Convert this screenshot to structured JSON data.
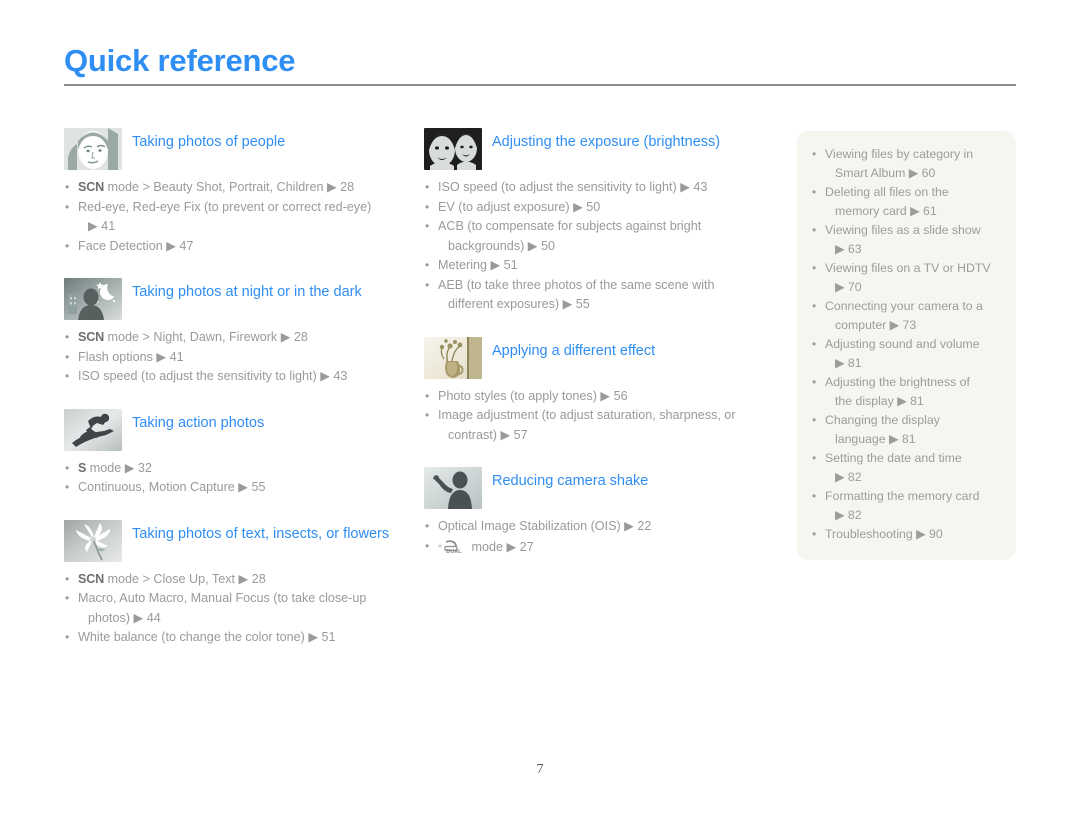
{
  "page": {
    "title": "Quick reference",
    "folio": "7",
    "accent_color": "#2f8ef4",
    "body_text_color": "#9a9a9a",
    "panel_bg_color": "#f6f5f0",
    "rule_color": "#8d8d8d"
  },
  "columns": {
    "left": [
      {
        "icon": "woman-portrait-thumbnail",
        "title": "Taking photos of people",
        "items": [
          {
            "mode": "SCN",
            "text": " mode > Beauty Shot, Portrait, Children ",
            "arrow": "▶",
            "page": "28"
          },
          {
            "mode": "",
            "text": "Red-eye, Red-eye Fix (to prevent or correct red-eye)",
            "cont": "▶ 41"
          },
          {
            "mode": "",
            "text": "Face Detection ",
            "arrow": "▶",
            "page": "47"
          }
        ]
      },
      {
        "icon": "night-scene-thumbnail",
        "title": "Taking photos at night or in the dark",
        "items": [
          {
            "mode": "SCN",
            "text": " mode > Night, Dawn, Firework ",
            "arrow": "▶",
            "page": "28"
          },
          {
            "mode": "",
            "text": "Flash options ",
            "arrow": "▶",
            "page": "41"
          },
          {
            "mode": "",
            "text": "ISO speed (to adjust the sensitivity to light) ",
            "arrow": "▶",
            "page": "43"
          }
        ]
      },
      {
        "icon": "snowboarder-thumbnail",
        "title": "Taking action photos",
        "items": [
          {
            "mode": "S",
            "text": " mode ",
            "arrow": "▶",
            "page": "32"
          },
          {
            "mode": "",
            "text": "Continuous, Motion Capture ",
            "arrow": "▶",
            "page": "55"
          }
        ]
      },
      {
        "icon": "flower-macro-thumbnail",
        "title": "Taking photos of text, insects, or flowers",
        "items": [
          {
            "mode": "SCN",
            "text": " mode > Close Up, Text ",
            "arrow": "▶",
            "page": "28"
          },
          {
            "mode": "",
            "text": "Macro, Auto Macro, Manual Focus (to take close-up photos) ",
            "cont": "▶ 44",
            "wrap_text": "Macro, Auto Macro, Manual Focus (to take close-up",
            "wrap_cont": "photos) ▶ 44"
          },
          {
            "mode": "",
            "text": "White balance (to change the color tone) ",
            "arrow": "▶",
            "page": "51"
          }
        ]
      }
    ],
    "middle": [
      {
        "icon": "two-faces-exposure-thumbnail",
        "title": "Adjusting the exposure (brightness)",
        "items": [
          {
            "mode": "",
            "text": "ISO speed (to adjust the sensitivity to light) ",
            "arrow": "▶",
            "page": "43"
          },
          {
            "mode": "",
            "text": "EV (to adjust exposure) ",
            "arrow": "▶",
            "page": "50"
          },
          {
            "mode": "",
            "wrap_text": "ACB (to compensate for subjects against bright",
            "wrap_cont": "backgrounds) ▶ 50"
          },
          {
            "mode": "",
            "text": "Metering ",
            "arrow": "▶",
            "page": "51"
          },
          {
            "mode": "",
            "wrap_text": "AEB (to take three photos of the same scene with",
            "wrap_cont": "different exposures) ▶ 55"
          }
        ]
      },
      {
        "icon": "vase-flowers-effect-thumbnail",
        "title": "Applying a different effect",
        "items": [
          {
            "mode": "",
            "text": "Photo styles (to apply tones) ",
            "arrow": "▶",
            "page": "56"
          },
          {
            "mode": "",
            "wrap_text": "Image adjustment (to adjust saturation, sharpness, or",
            "wrap_cont": "contrast) ▶ 57"
          }
        ]
      },
      {
        "icon": "person-waving-shake-thumbnail",
        "title": "Reducing camera shake",
        "items": [
          {
            "mode": "",
            "text": "Optical Image Stabilization (OIS) ",
            "arrow": "▶",
            "page": "22"
          },
          {
            "mode": "DUAL_ICON",
            "text": " mode ",
            "arrow": "▶",
            "page": "27"
          }
        ]
      }
    ]
  },
  "side_panel": {
    "items": [
      {
        "line1": "Viewing files by category in",
        "line2": "Smart Album ▶ 60"
      },
      {
        "line1": "Deleting all files on the",
        "line2": "memory card ▶ 61"
      },
      {
        "line1": "Viewing files as a slide show",
        "line2": "▶ 63"
      },
      {
        "line1": "Viewing files on a TV or HDTV",
        "line2": "▶ 70"
      },
      {
        "line1": "Connecting your camera to a",
        "line2": "computer ▶ 73"
      },
      {
        "line1": "Adjusting sound and volume",
        "line2": "▶ 81"
      },
      {
        "line1": "Adjusting the brightness of",
        "line2": "the display ▶ 81"
      },
      {
        "line1": "Changing the display",
        "line2": "language ▶ 81"
      },
      {
        "line1": "Setting the date and time",
        "line2": "▶ 82"
      },
      {
        "line1": "Formatting the memory card",
        "line2": "▶ 82"
      },
      {
        "line1": "Troubleshooting ▶ 90",
        "line2": ""
      }
    ]
  }
}
